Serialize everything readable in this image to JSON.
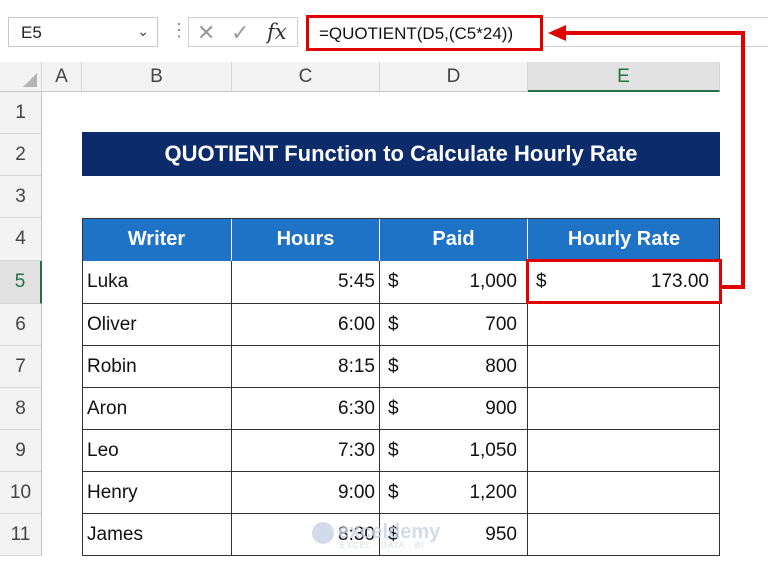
{
  "namebox": {
    "value": "E5",
    "dropdown_icon": "chevron-down-icon"
  },
  "formula_bar": {
    "formula": "=QUOTIENT(D5,(C5*24))",
    "cancel_icon": "✕",
    "enter_icon": "✓",
    "fx_label": "fx"
  },
  "columns": [
    "A",
    "B",
    "C",
    "D",
    "E"
  ],
  "rows": [
    "1",
    "2",
    "3",
    "4",
    "5",
    "6",
    "7",
    "8",
    "9",
    "10",
    "11"
  ],
  "title": "QUOTIENT Function to Calculate Hourly Rate",
  "table": {
    "headers": [
      "Writer",
      "Hours",
      "Paid",
      "Hourly Rate"
    ],
    "rows": [
      {
        "writer": "Luka",
        "hours": "5:45",
        "paid_sym": "$",
        "paid": "1,000",
        "rate_sym": "$",
        "rate": "173.00"
      },
      {
        "writer": "Oliver",
        "hours": "6:00",
        "paid_sym": "$",
        "paid": "700",
        "rate_sym": "",
        "rate": ""
      },
      {
        "writer": "Robin",
        "hours": "8:15",
        "paid_sym": "$",
        "paid": "800",
        "rate_sym": "",
        "rate": ""
      },
      {
        "writer": "Aron",
        "hours": "6:30",
        "paid_sym": "$",
        "paid": "900",
        "rate_sym": "",
        "rate": ""
      },
      {
        "writer": "Leo",
        "hours": "7:30",
        "paid_sym": "$",
        "paid": "1,050",
        "rate_sym": "",
        "rate": ""
      },
      {
        "writer": "Henry",
        "hours": "9:00",
        "paid_sym": "$",
        "paid": "1,200",
        "rate_sym": "",
        "rate": ""
      },
      {
        "writer": "James",
        "hours": "8:30",
        "paid_sym": "$",
        "paid": "950",
        "rate_sym": "",
        "rate": ""
      }
    ]
  },
  "watermark": {
    "name": "exceldemy",
    "tagline": "EXCEL · DATA · BI"
  },
  "colors": {
    "title_bg": "#0b2b6b",
    "header_bg": "#1f73c6",
    "highlight": "#e00000",
    "selected_green": "#217346"
  }
}
